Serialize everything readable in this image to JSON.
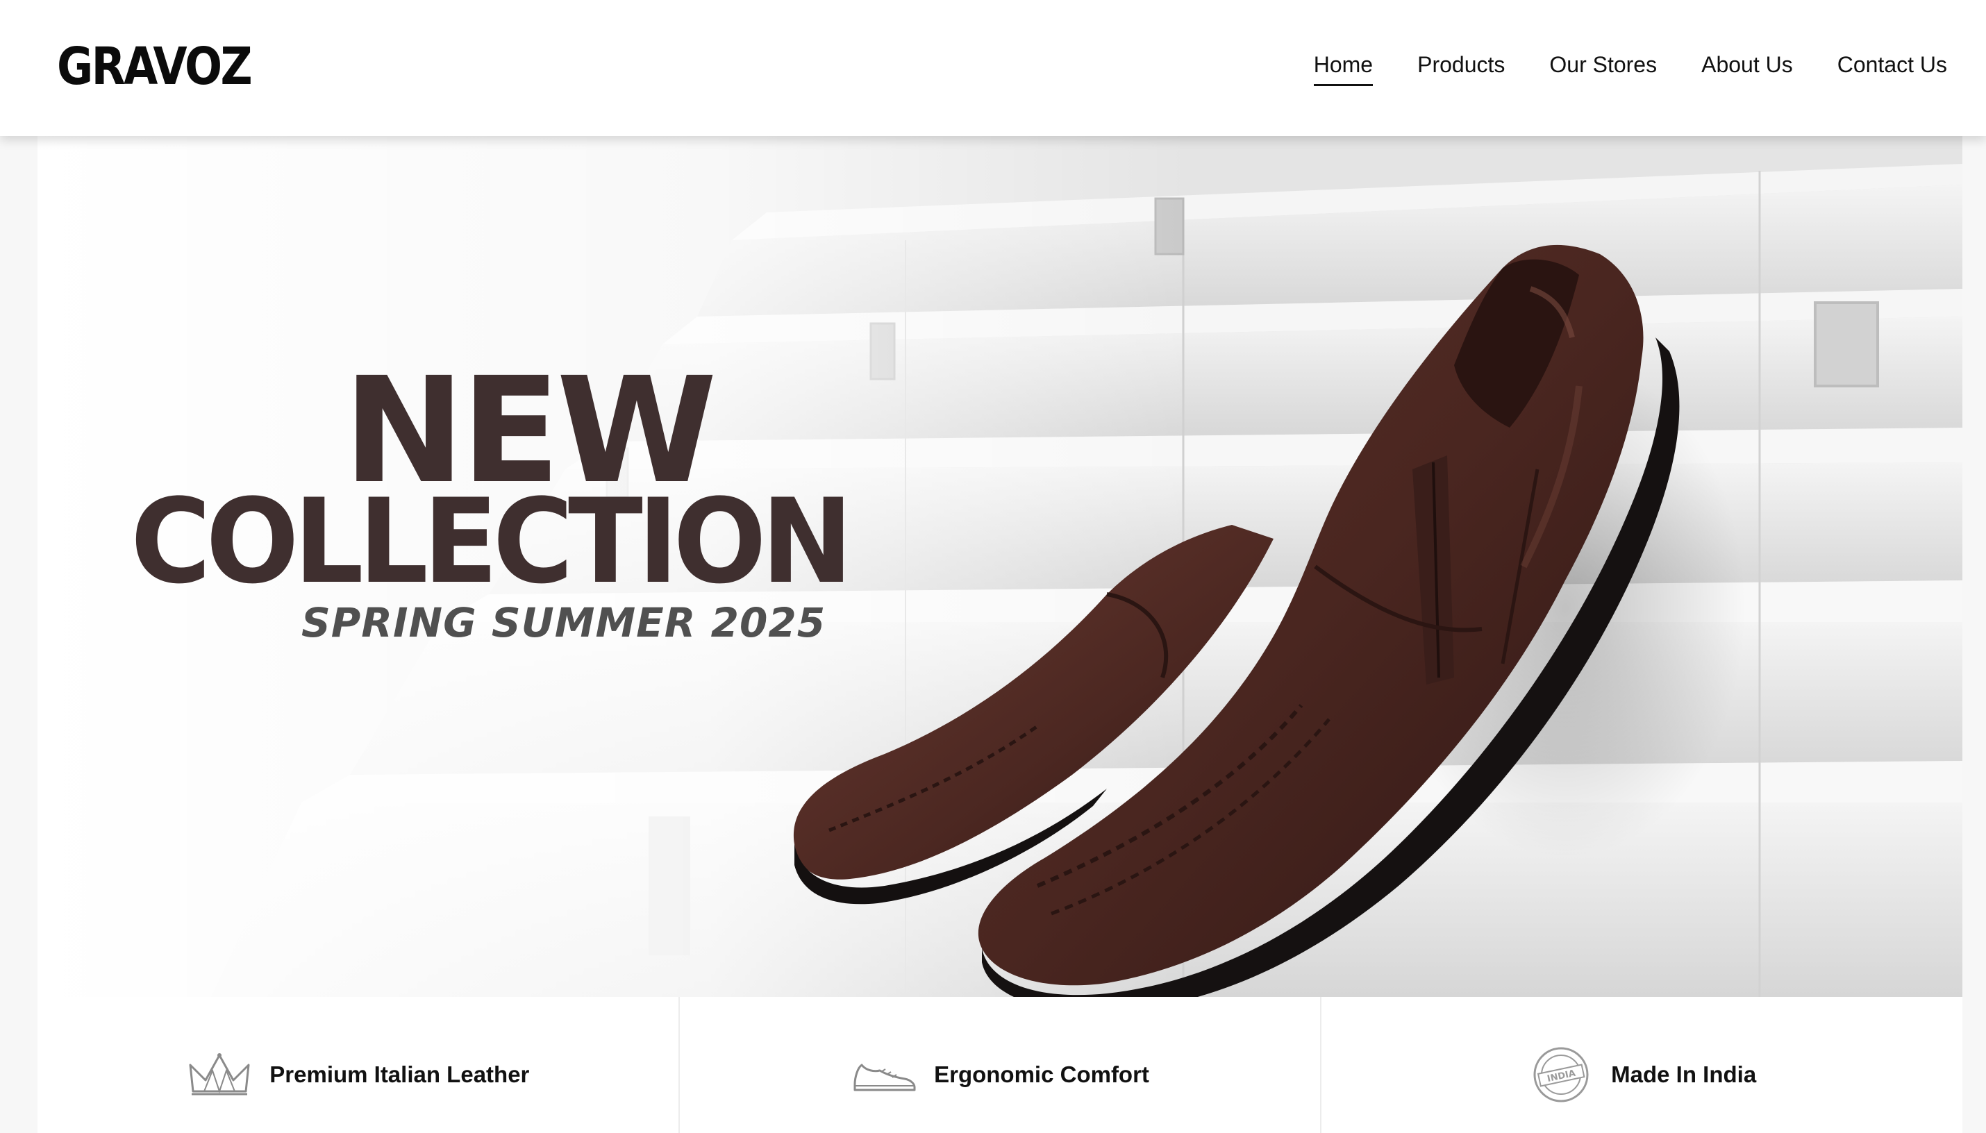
{
  "brand": {
    "name": "GRAVOZ"
  },
  "nav": {
    "items": [
      {
        "label": "Home",
        "active": true
      },
      {
        "label": "Products",
        "active": false
      },
      {
        "label": "Our Stores",
        "active": false
      },
      {
        "label": "About Us",
        "active": false
      },
      {
        "label": "Contact Us",
        "active": false
      }
    ]
  },
  "hero": {
    "line1": "NEW",
    "line2": "COLLECTION",
    "subtitle": "SPRING SUMMER 2025",
    "title_color": "#3f2f2f",
    "subtitle_color": "#505050",
    "shoe_color": "#4a2620"
  },
  "features": [
    {
      "icon": "crown-icon",
      "label": "Premium Italian Leather"
    },
    {
      "icon": "shoe-icon",
      "label": "Ergonomic Comfort"
    },
    {
      "icon": "made-in-india-stamp-icon",
      "label": "Made In India",
      "stamp_text": "INDIA"
    }
  ]
}
